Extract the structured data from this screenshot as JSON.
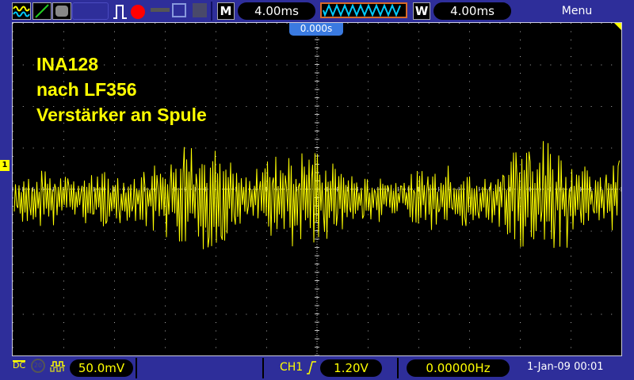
{
  "toolbar": {
    "timebase_badge": "M",
    "timebase": "4.00ms",
    "window_badge": "W",
    "window_timebase": "4.00ms",
    "menu": "Menu",
    "run_state_color": "#ff0000"
  },
  "screen": {
    "trigger_position": "0.000s",
    "channel_marker": "1",
    "annotation": [
      "INA128",
      "nach LF356",
      "Verstärker an Spule"
    ]
  },
  "status": {
    "coupling": "DC",
    "bw_limit": "20",
    "ch1_scale": "50.0mV",
    "trigger_source": "CH1",
    "trigger_level": "1.20V",
    "frequency": "0.00000Hz",
    "datetime": "1-Jan-09 00:01"
  },
  "colors": {
    "ch1": "#ffff00",
    "background": "#2e2e9a",
    "pill_border": "#d86a2a"
  }
}
